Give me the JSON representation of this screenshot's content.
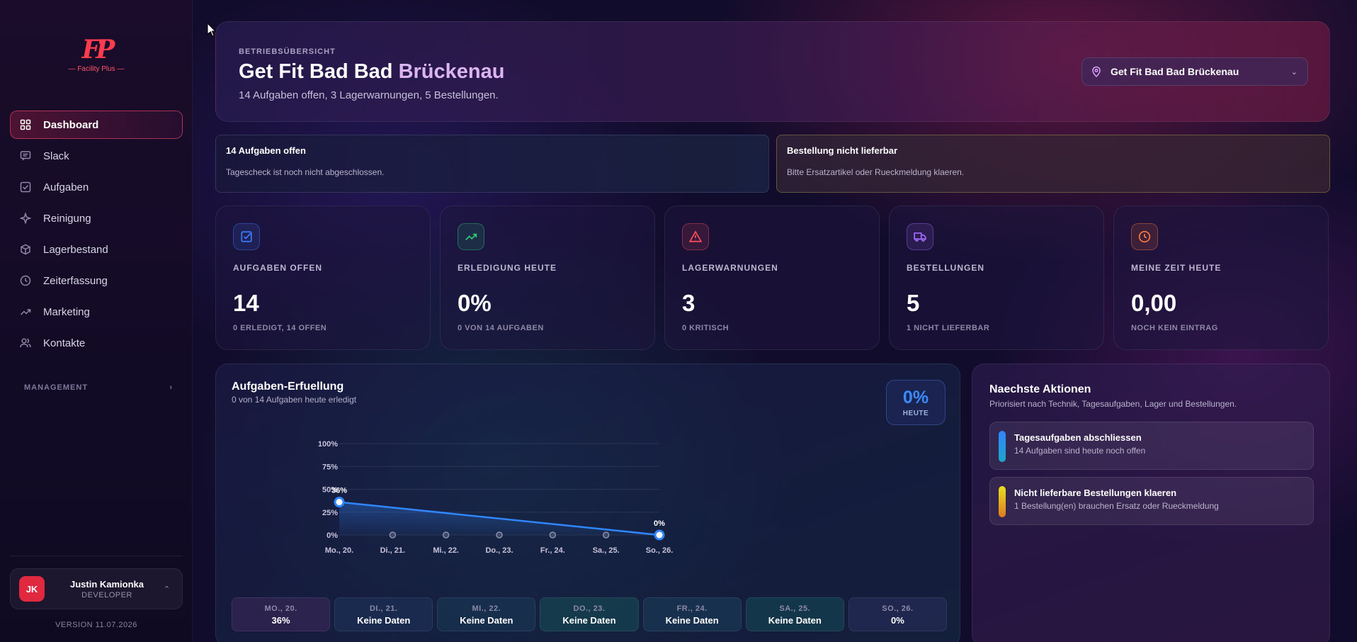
{
  "brand": {
    "mark": "FP",
    "name": "— Facility Plus —"
  },
  "sidebar": {
    "items": [
      {
        "label": "Dashboard",
        "icon": "grid-icon",
        "active": true
      },
      {
        "label": "Slack",
        "icon": "chat-icon"
      },
      {
        "label": "Aufgaben",
        "icon": "checkbox-icon"
      },
      {
        "label": "Reinigung",
        "icon": "sparkle-icon"
      },
      {
        "label": "Lagerbestand",
        "icon": "box-icon"
      },
      {
        "label": "Zeiterfassung",
        "icon": "clock-icon"
      },
      {
        "label": "Marketing",
        "icon": "trend-icon"
      },
      {
        "label": "Kontakte",
        "icon": "users-icon"
      }
    ],
    "section_label": "MANAGEMENT",
    "section_chevron": "›",
    "user": {
      "initials": "JK",
      "name": "Justin Kamionka",
      "role": "DEVELOPER",
      "chevron": "⌃"
    },
    "version": "VERSION 11.07.2026"
  },
  "header": {
    "eyebrow": "BETRIEBSÜBERSICHT",
    "title_part1": "Get Fit Bad Bad",
    "title_part2": "Brückenau",
    "subtitle": "14 Aufgaben offen, 3 Lagerwarnungen, 5 Bestellungen.",
    "location": "Get Fit Bad Bad Brückenau",
    "location_chevron": "⌄"
  },
  "alerts": [
    {
      "title": "14 Aufgaben offen",
      "text": "Tagescheck ist noch nicht abgeschlossen."
    },
    {
      "title": "Bestellung nicht lieferbar",
      "text": "Bitte Ersatzartikel oder Rueckmeldung klaeren."
    }
  ],
  "stats": [
    {
      "label": "AUFGABEN OFFEN",
      "value": "14",
      "sub": "0 ERLEDIGT, 14 OFFEN",
      "color": "#3b7dff"
    },
    {
      "label": "ERLEDIGUNG HEUTE",
      "value": "0%",
      "sub": "0 VON 14 AUFGABEN",
      "color": "#2ecc71"
    },
    {
      "label": "LAGERWARNUNGEN",
      "value": "3",
      "sub": "0 KRITISCH",
      "color": "#ff4d5e"
    },
    {
      "label": "BESTELLUNGEN",
      "value": "5",
      "sub": "1 NICHT LIEFERBAR",
      "color": "#a46bff"
    },
    {
      "label": "MEINE ZEIT HEUTE",
      "value": "0,00",
      "sub": "NOCH KEIN EINTRAG",
      "color": "#ff7a3d"
    }
  ],
  "chart_panel": {
    "title": "Aufgaben-Erfuellung",
    "subtitle": "0 von 14 Aufgaben heute erledigt",
    "today_value": "0%",
    "today_label": "HEUTE",
    "days": [
      {
        "name": "MO., 20.",
        "value": "36%"
      },
      {
        "name": "DI., 21.",
        "value": "Keine Daten"
      },
      {
        "name": "MI., 22.",
        "value": "Keine Daten"
      },
      {
        "name": "DO., 23.",
        "value": "Keine Daten"
      },
      {
        "name": "FR., 24.",
        "value": "Keine Daten"
      },
      {
        "name": "SA., 25.",
        "value": "Keine Daten"
      },
      {
        "name": "SO., 26.",
        "value": "0%"
      }
    ]
  },
  "chart_data": {
    "type": "line",
    "categories": [
      "Mo., 20.",
      "Di., 21.",
      "Mi., 22.",
      "Do., 23.",
      "Fr., 24.",
      "Sa., 25.",
      "So., 26."
    ],
    "series": [
      {
        "values": [
          36,
          null,
          null,
          null,
          null,
          null,
          0
        ]
      }
    ],
    "point_labels": [
      "36%",
      "",
      "",
      "",
      "",
      "",
      "0%"
    ],
    "yticks": [
      "0%",
      "25%",
      "50%",
      "75%",
      "100%"
    ],
    "ylim": [
      0,
      100
    ],
    "grid": true,
    "line_color": "#2f86ff"
  },
  "actions_panel": {
    "title": "Naechste Aktionen",
    "subtitle": "Priorisiert nach Technik, Tagesaufgaben, Lager und Bestellungen.",
    "items": [
      {
        "title": "Tagesaufgaben abschliessen",
        "text": "14 Aufgaben sind heute noch offen",
        "color_top": "#2f86ff",
        "color_bottom": "#1ea5c8"
      },
      {
        "title": "Nicht lieferbare Bestellungen klaeren",
        "text": "1 Bestellung(en) brauchen Ersatz oder Rueckmeldung",
        "color_top": "#e8e020",
        "color_bottom": "#e07a1e"
      }
    ]
  }
}
